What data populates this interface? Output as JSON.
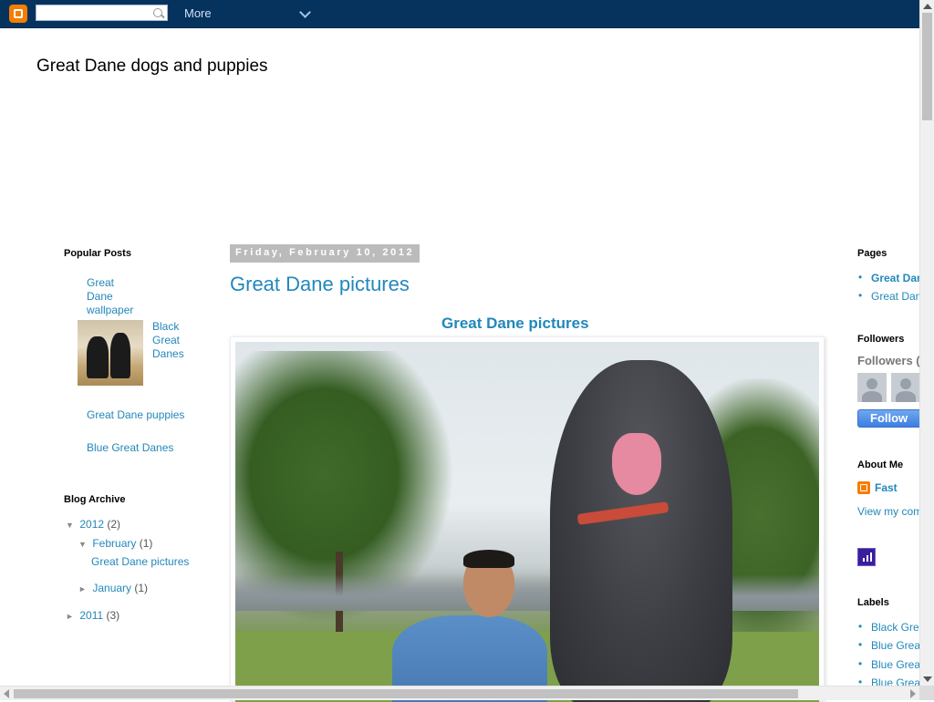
{
  "navbar": {
    "search_placeholder": "",
    "more_label": "More"
  },
  "blog": {
    "title": "Great Dane dogs and puppies"
  },
  "popular_posts": {
    "title": "Popular Posts",
    "items": [
      {
        "label_line1": "Great Dane",
        "label_line2": "wallpaper"
      },
      {
        "label_line1": "Black",
        "label_line2": "Great",
        "label_line3": "Danes"
      },
      {
        "label": "Great Dane puppies"
      },
      {
        "label": "Blue Great Danes"
      }
    ]
  },
  "blog_archive": {
    "title": "Blog Archive",
    "years": [
      {
        "year": "2012",
        "count": "(2)",
        "expanded_marker": "▼"
      },
      {
        "year": "2011",
        "count": "(3)",
        "expanded_marker": "►"
      }
    ],
    "months": [
      {
        "month": "February",
        "count": "(1)",
        "expanded_marker": "▼"
      },
      {
        "month": "January",
        "count": "(1)",
        "expanded_marker": "►"
      }
    ],
    "posts": [
      "Great Dane pictures"
    ]
  },
  "post": {
    "date": "Friday, February 10, 2012",
    "title": "Great Dane pictures",
    "subtitle": "Great Dane pictures"
  },
  "right_sidebar": {
    "pages": {
      "title": "Pages",
      "items": [
        "Great Dan",
        "Great Dan"
      ]
    },
    "followers": {
      "title": "Followers",
      "count_label": "Followers (",
      "follow_button": "Follow"
    },
    "about": {
      "title": "About Me",
      "name": "Fast",
      "view_profile": "View my com"
    },
    "labels": {
      "title": "Labels",
      "items": [
        "Black Gre",
        "Blue Grea",
        "Blue Grea",
        "Blue Grea"
      ]
    }
  },
  "colors": {
    "navbar_bg": "#06335e",
    "link": "#2288bb",
    "date_header_bg": "#bbbbbb",
    "blogger_orange": "#f57d00",
    "follow_button": "#3d7ee0"
  }
}
